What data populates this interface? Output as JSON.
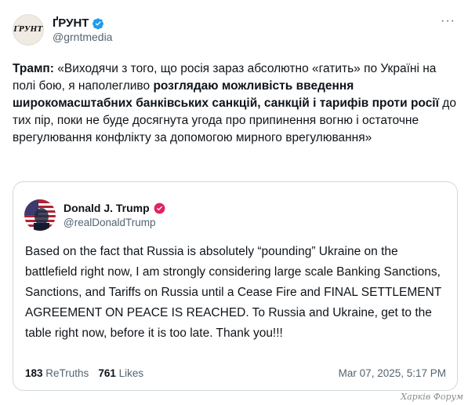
{
  "author": {
    "display_name": "ҐРУНТ",
    "handle": "@grntmedia",
    "avatar_text": "ҐРУНТ",
    "avatar_icon": "logo-icon",
    "verified_icon": "verified-badge-icon",
    "more_icon": "more-options-icon",
    "more_label": "···"
  },
  "tweet": {
    "segments": [
      {
        "text": "Трамп:",
        "bold": true
      },
      {
        "text": " «Виходячи з того, що росія зараз абсолютно «гатить» по Україні на полі бою, я наполегливо ",
        "bold": false
      },
      {
        "text": "розглядаю можливість введення широкомасштабних банківських санкцій, санкцій і тарифів проти росії",
        "bold": true
      },
      {
        "text": " до тих пір, поки не буде досягнута угода про припинення вогню і остаточне врегулювання конфлікту за допомогою мирного врегулювання»",
        "bold": false
      }
    ]
  },
  "quote": {
    "display_name": "Donald J. Trump",
    "handle": "@realDonaldTrump",
    "badge_icon": "verified-badge-icon",
    "text": "Based on the fact that Russia is absolutely “pounding” Ukraine on the battlefield right now, I am strongly considering large scale Banking Sanctions, Sanctions, and Tariffs on Russia until a Cease Fire and FINAL SETTLEMENT AGREEMENT ON PEACE IS REACHED. To Russia and Ukraine, get to the table right now, before it is too late. Thank you!!!",
    "retruths_count": "183",
    "retruths_label": "ReTruths",
    "likes_count": "761",
    "likes_label": "Likes",
    "date": "Mar 07, 2025, 5:17 PM"
  },
  "watermark": "Харків Форум",
  "colors": {
    "accent": "#1d9bf0",
    "badge_red": "#e0245e",
    "text_primary": "#0f1419",
    "text_secondary": "#536471",
    "border": "#cfd9de"
  }
}
